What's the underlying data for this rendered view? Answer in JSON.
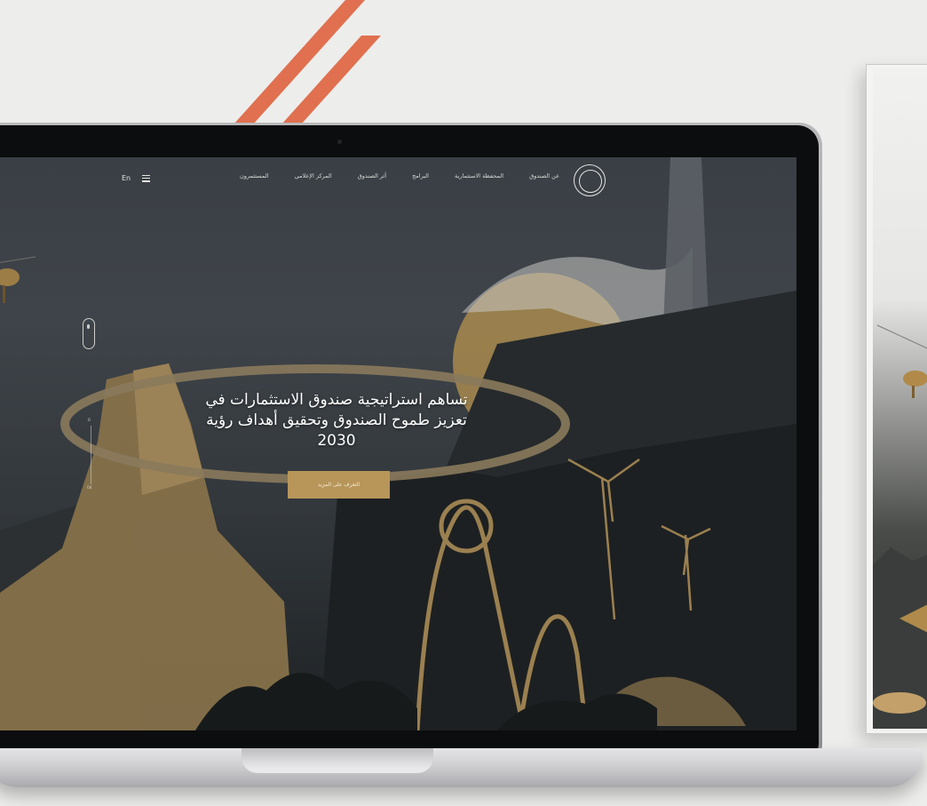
{
  "navigation": {
    "links": [
      "عن الصندوق",
      "المحفظة الاستثمارية",
      "البرامج",
      "أثر الصندوق",
      "المركز الإعلامي",
      "المستثمرون"
    ],
    "language_toggle": "En"
  },
  "hero": {
    "headline_line1": "تساهم استراتيجية صندوق الاستثمارات في",
    "headline_line2": "تعزيز طموح الصندوق وتحقيق أهداف رؤية",
    "headline_line3": "2030",
    "cta_label": "التعرف على المزيد"
  },
  "slider": {
    "current": "0",
    "total": "04"
  },
  "colors": {
    "accent_gold": "#b8965a",
    "stripe": "#e0704f",
    "nav_text": "#d9d9d6"
  },
  "icons": [
    "menu-icon",
    "emblem-logo-icon",
    "scroll-mouse-icon"
  ]
}
